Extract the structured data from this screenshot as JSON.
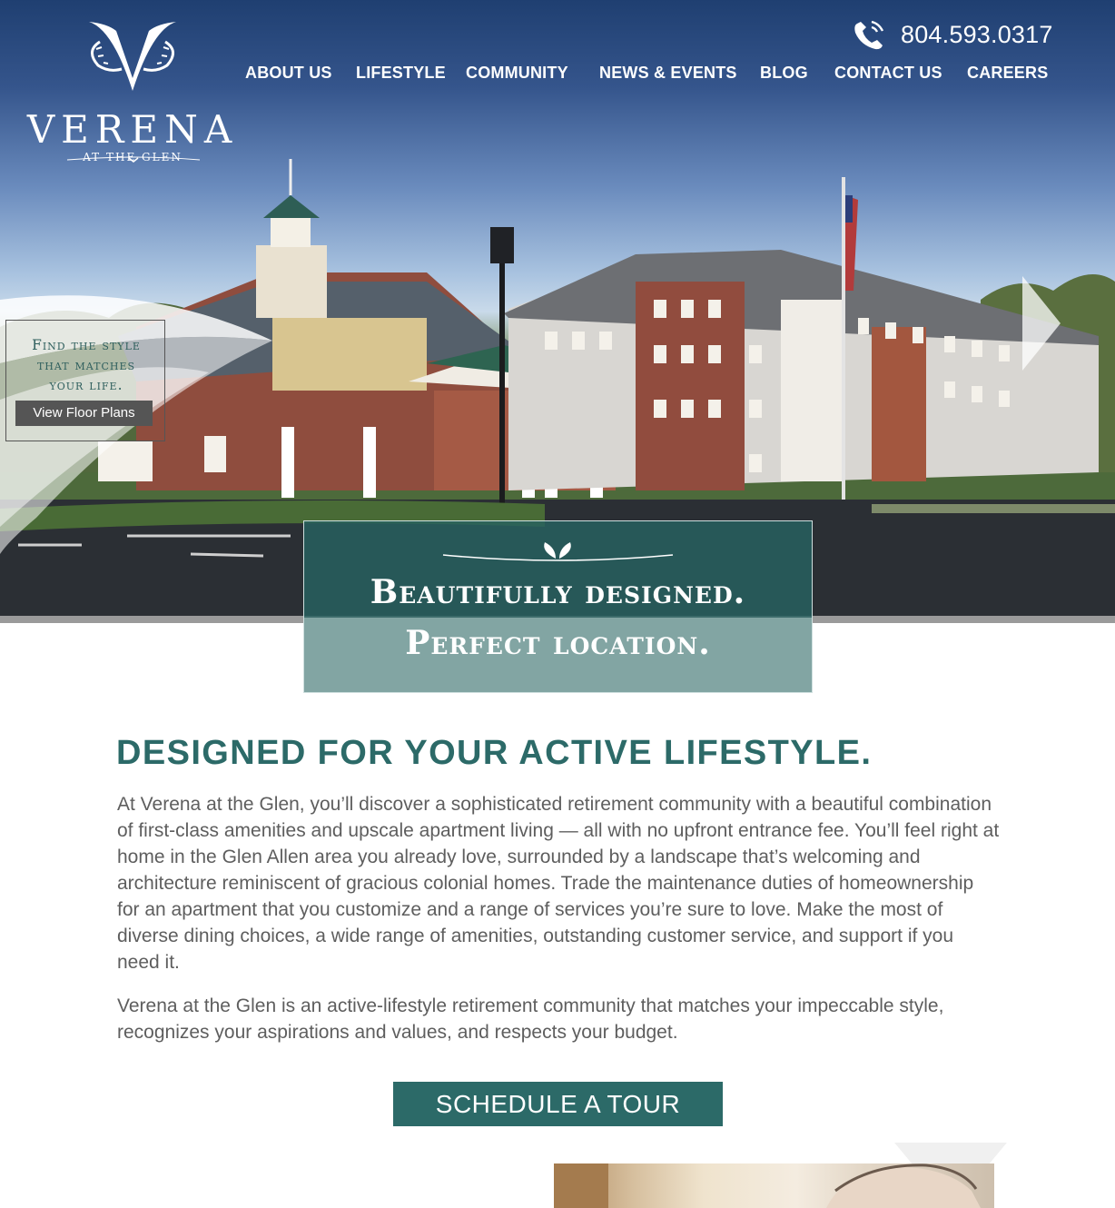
{
  "brand": {
    "logo_name": "VERENA",
    "logo_sub": "AT THE GLEN"
  },
  "header": {
    "phone": "804.593.0317",
    "nav": [
      "ABOUT US",
      "LIFESTYLE",
      "COMMUNITY",
      "NEWS & EVENTS",
      "BLOG",
      "CONTACT US",
      "CAREERS"
    ]
  },
  "promo": {
    "text_line1": "Find the style",
    "text_line2": "that matches",
    "text_line3": "your life.",
    "button": "View Floor Plans"
  },
  "tagline": {
    "line1": "Beautifully designed.",
    "line2": "Perfect location."
  },
  "main": {
    "headline": "DESIGNED FOR YOUR ACTIVE LIFESTYLE.",
    "paragraph1": "At Verena at the Glen, you’ll discover a sophisticated retirement community with a beautiful combination of first-class amenities and upscale apartment living — all with no upfront entrance fee. You’ll feel right at home in the Glen Allen area you already love, surrounded by a landscape that’s welcoming and architecture reminiscent of gracious colonial homes. Trade the maintenance duties of homeownership for an apartment that you customize and a range of services you’re sure to love. Make the most of diverse dining choices, a wide range of amenities, outstanding customer service, and support if you need it.",
    "paragraph2": "Verena at the Glen is an active-lifestyle retirement community that matches your impeccable style, recognizes your aspirations and values, and respects your budget.",
    "cta": "SCHEDULE A TOUR"
  },
  "icons": {
    "phone": "phone-icon",
    "next": "chevron-right-icon",
    "ornament": "leaf-ornament-icon"
  },
  "colors": {
    "teal": "#2c6a68",
    "teal_light": "#82a5a3",
    "body_text": "#5e5e5e",
    "promo_button": "#555555"
  }
}
